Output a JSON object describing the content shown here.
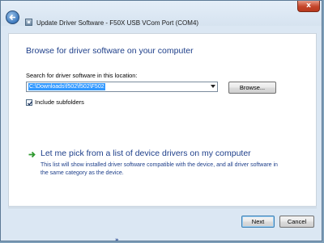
{
  "window": {
    "title": "Update Driver Software - F50X USB VCom Port (COM4)",
    "close_label": "x"
  },
  "main": {
    "heading": "Browse for driver software on your computer",
    "search_label": "Search for driver software in this location:",
    "location_value": "C:\\Downloads\\f502\\f502\\F502",
    "browse_label": "Browse...",
    "include_subfolders_label": "Include subfolders",
    "include_subfolders_checked": true,
    "pick_link_title": "Let me pick from a list of device drivers on my computer",
    "pick_link_desc": "This list will show installed driver software compatible with the device, and all driver software in the same category as the device."
  },
  "footer": {
    "next_label": "Next",
    "cancel_label": "Cancel"
  },
  "taskbar": {
    "mark": "»"
  },
  "colors": {
    "heading": "#1e3f8a",
    "background": "#dbe7f3",
    "selection": "#3399ff",
    "arrow_green": "#2e9a2e"
  }
}
